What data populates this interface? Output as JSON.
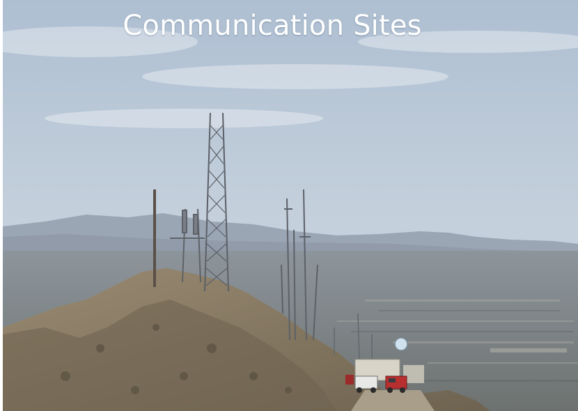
{
  "slide": {
    "title": "Communication Sites"
  },
  "photo": {
    "subject": "mountain-top-communication-towers",
    "colors": {
      "sky_top": "#b9c8d8",
      "sky_bottom": "#c6d2dc",
      "distant_mountains": "#9aa6b4",
      "valley": "#7f8688",
      "ridge": "#8a7d68",
      "tower": "#5c6068",
      "truck_red": "#b82f2f"
    }
  }
}
